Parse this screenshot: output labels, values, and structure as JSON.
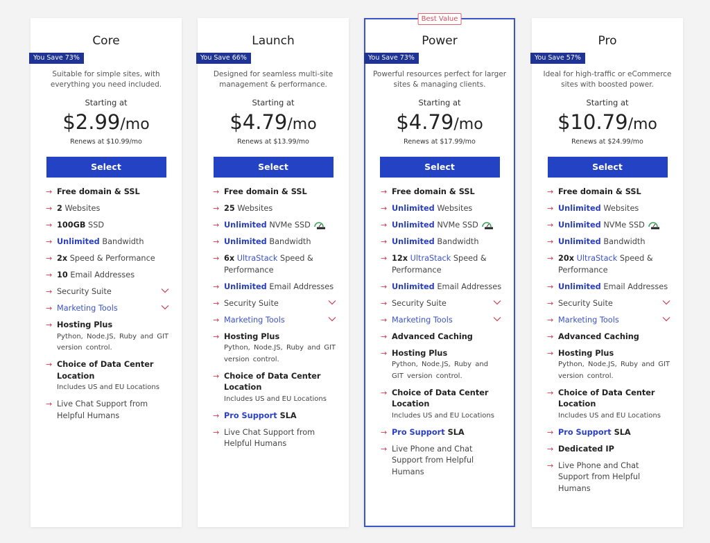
{
  "plans": [
    {
      "name": "Core",
      "save": "You Save 73%",
      "desc": "Suitable for simple sites, with everything you need included.",
      "starting": "Starting at",
      "price": "$2.99",
      "per": "/mo",
      "renews": "Renews at $10.99/mo",
      "select": "Select",
      "features": {
        "free_domain": "Free domain & SSL",
        "websites_strong": "2",
        "websites_text": " Websites",
        "ssd_strong": "100GB",
        "ssd_text": " SSD",
        "bandwidth_strong": "Unlimited",
        "bandwidth_text": " Bandwidth",
        "speed_strong": "2x",
        "speed_text": " Speed & Performance",
        "email_strong": "10",
        "email_text": " Email Addresses",
        "security": "Security Suite",
        "marketing": "Marketing Tools",
        "hosting_plus": "Hosting Plus",
        "hosting_plus_sub": "Python, Node.JS, Ruby and GIT version control.",
        "datacenter": "Choice of Data Center Location",
        "datacenter_sub": "Includes US and EU Locations",
        "support": "Live Chat Support from Helpful Humans"
      }
    },
    {
      "name": "Launch",
      "save": "You Save 66%",
      "desc": "Designed for seamless multi-site management & performance.",
      "starting": "Starting at",
      "price": "$4.79",
      "per": "/mo",
      "renews": "Renews at $13.99/mo",
      "select": "Select",
      "features": {
        "free_domain": "Free domain & SSL",
        "websites_strong": "25",
        "websites_text": " Websites",
        "ssd_strong": "Unlimited",
        "ssd_text": " NVMe SSD",
        "bandwidth_strong": "Unlimited",
        "bandwidth_text": " Bandwidth",
        "speed_strong": "6x",
        "speed_link": "UltraStack",
        "speed_text": " Speed & Performance",
        "email_strong": "Unlimited",
        "email_text": " Email Addresses",
        "security": "Security Suite",
        "marketing": "Marketing Tools",
        "hosting_plus": "Hosting Plus",
        "hosting_plus_sub": "Python, Node.JS, Ruby and GIT version control.",
        "datacenter": "Choice of Data Center Location",
        "datacenter_sub": "Includes US and EU Locations",
        "pro_support_strong": "Pro Support",
        "pro_support_text": " SLA",
        "support": "Live Chat Support from Helpful Humans"
      }
    },
    {
      "name": "Power",
      "best_value": "Best Value",
      "save": "You Save 73%",
      "desc": "Powerful resources perfect for larger sites & managing clients.",
      "starting": "Starting at",
      "price": "$4.79",
      "per": "/mo",
      "renews": "Renews at $17.99/mo",
      "select": "Select",
      "features": {
        "free_domain": "Free domain & SSL",
        "websites_strong": "Unlimited",
        "websites_text": " Websites",
        "ssd_strong": "Unlimited",
        "ssd_text": " NVMe SSD",
        "bandwidth_strong": "Unlimited",
        "bandwidth_text": " Bandwidth",
        "speed_strong": "12x",
        "speed_link": "UltraStack",
        "speed_text": " Speed & Performance",
        "email_strong": "Unlimited",
        "email_text": " Email Addresses",
        "security": "Security Suite",
        "marketing": "Marketing Tools",
        "caching": "Advanced Caching",
        "hosting_plus": "Hosting Plus",
        "hosting_plus_sub": "Python, Node.JS, Ruby and GIT version control.",
        "datacenter": "Choice of Data Center Location",
        "datacenter_sub": "Includes US and EU Locations",
        "pro_support_strong": "Pro Support",
        "pro_support_text": " SLA",
        "support": "Live Phone and Chat Support from Helpful Humans"
      }
    },
    {
      "name": "Pro",
      "save": "You Save 57%",
      "desc": "Ideal for high-traffic or eCommerce sites with boosted power.",
      "starting": "Starting at",
      "price": "$10.79",
      "per": "/mo",
      "renews": "Renews at $24.99/mo",
      "select": "Select",
      "features": {
        "free_domain": "Free domain & SSL",
        "websites_strong": "Unlimited",
        "websites_text": " Websites",
        "ssd_strong": "Unlimited",
        "ssd_text": " NVMe SSD",
        "bandwidth_strong": "Unlimited",
        "bandwidth_text": " Bandwidth",
        "speed_strong": "20x",
        "speed_link": "UltraStack",
        "speed_text": " Speed & Performance",
        "email_strong": "Unlimited",
        "email_text": " Email Addresses",
        "security": "Security Suite",
        "marketing": "Marketing Tools",
        "caching": "Advanced Caching",
        "hosting_plus": "Hosting Plus",
        "hosting_plus_sub": "Python, Node.JS, Ruby and GIT version control.",
        "datacenter": "Choice of Data Center Location",
        "datacenter_sub": "Includes US and EU Locations",
        "pro_support_strong": "Pro Support",
        "pro_support_text": " SLA",
        "dedicated_ip": "Dedicated IP",
        "support": "Live Phone and Chat Support from Helpful Humans"
      }
    }
  ],
  "icons": {
    "arrow": "→",
    "speed_badge_text": "SPEED"
  },
  "colors": {
    "accent_blue": "#2342c4",
    "save_badge": "#1e3393",
    "arrow_red": "#d43a4c",
    "best_value_red": "#d24c5c",
    "background": "#f3f3f3"
  }
}
